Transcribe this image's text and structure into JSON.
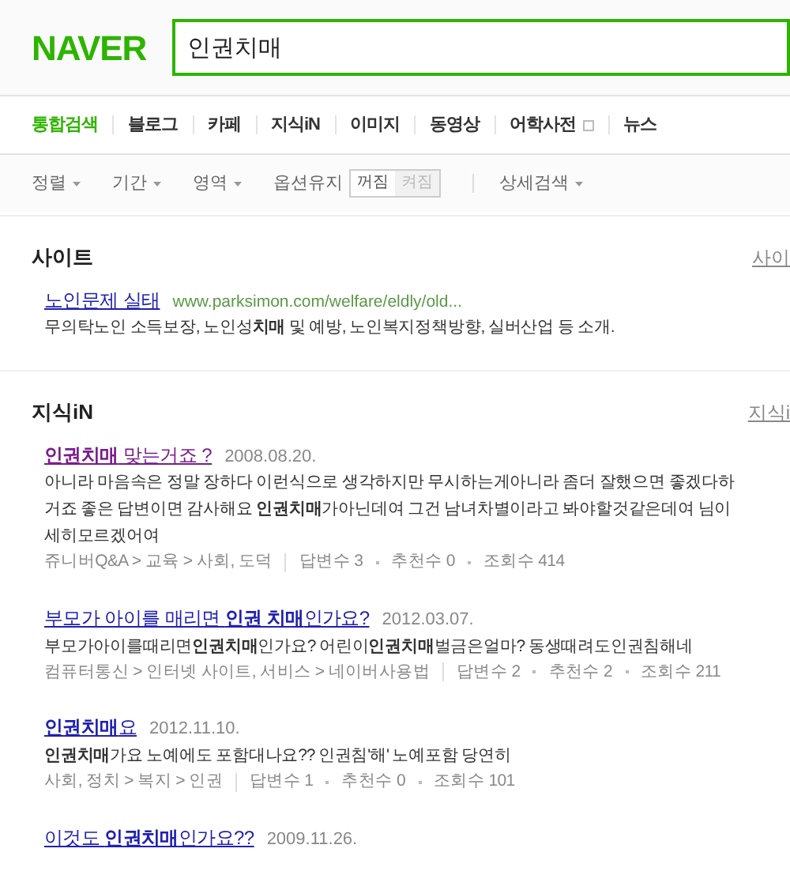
{
  "logo": "NAVER",
  "search": {
    "value": "인권치매"
  },
  "tabs": [
    {
      "label": "통합검색",
      "selected": true,
      "external": false
    },
    {
      "label": "블로그",
      "selected": false,
      "external": false
    },
    {
      "label": "카페",
      "selected": false,
      "external": false
    },
    {
      "label": "지식iN",
      "selected": false,
      "external": false
    },
    {
      "label": "이미지",
      "selected": false,
      "external": false
    },
    {
      "label": "동영상",
      "selected": false,
      "external": false
    },
    {
      "label": "어학사전",
      "selected": false,
      "external": true
    },
    {
      "label": "뉴스",
      "selected": false,
      "external": false
    }
  ],
  "filters": [
    {
      "kind": "dropdown",
      "label": "정렬"
    },
    {
      "kind": "dropdown",
      "label": "기간"
    },
    {
      "kind": "dropdown",
      "label": "영역"
    },
    {
      "kind": "toggle",
      "label": "옵션유지",
      "options": [
        {
          "label": "꺼짐",
          "selected": true
        },
        {
          "label": "켜짐",
          "selected": false
        }
      ]
    },
    {
      "kind": "dropdown",
      "label": "상세검색"
    }
  ],
  "sections": [
    {
      "title": "사이트",
      "more": "사이",
      "results": [
        {
          "title": "노인문제 실태",
          "visited": false,
          "url": "www.parksimon.com/welfare/eldly/old...",
          "lines": [
            "무의탁노인 소득보장, 노인성**치매** 및 예방, 노인복지정책방향, 실버산업 등 소개."
          ]
        }
      ]
    },
    {
      "title": "지식iN",
      "more": "지식i",
      "results": [
        {
          "title": "**인권치매** 맞는거죠 ?",
          "visited": true,
          "date": "2008.08.20.",
          "lines": [
            "아니라 마음속은 정말 장하다 이런식으로 생각하지만 무시하는게아니라 좀더 잘했으면 좋겠다하",
            "거죠 좋은 답변이면 감사해요 **인권치매**가아닌데여 그건 남녀차별이라고 봐야할것같은데여 님이",
            "세히모르겠어여"
          ],
          "path": "쥬니버Q&A > 교육 > 사회, 도덕",
          "stats": [
            "답변수 3",
            "추천수 0",
            "조회수 414"
          ]
        },
        {
          "title": "부모가 아이를 매리면 **인권 치매**인가요?",
          "visited": false,
          "date": "2012.03.07.",
          "lines": [
            "부모가아이를때리면**인권치매**인가요? 어린이**인권치매**벌금은얼마? 동생때려도인권침해네"
          ],
          "path": "컴퓨터통신 > 인터넷 사이트, 서비스 > 네이버사용법",
          "stats": [
            "답변수 2",
            "추천수 2",
            "조회수 211"
          ]
        },
        {
          "title": "**인권치매**요",
          "visited": false,
          "date": "2012.11.10.",
          "lines": [
            "**인권치매**가요 노예에도 포함대나요?? 인권침'해' 노예포함 당연히"
          ],
          "path": "사회, 정치 > 복지 > 인권",
          "stats": [
            "답변수 1",
            "추천수 0",
            "조회수 101"
          ]
        },
        {
          "title": "이것도 **인권치매**인가요??",
          "visited": false,
          "date": "2009.11.26."
        }
      ]
    }
  ]
}
